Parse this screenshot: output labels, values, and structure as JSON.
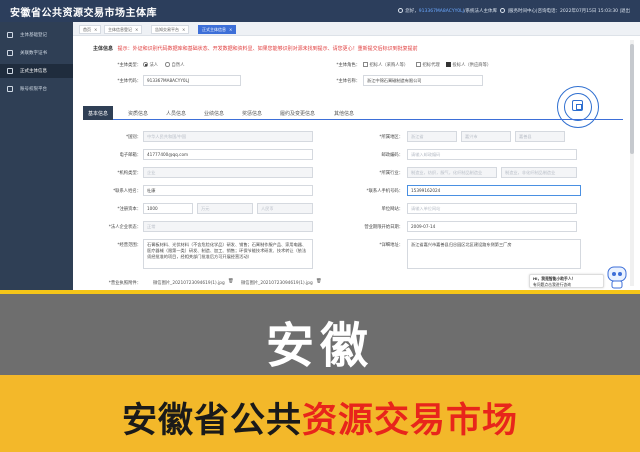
{
  "app": {
    "title": "安徽省公共资源交易市场主体库",
    "topbar": {
      "welcome_prefix": "您好，",
      "user": "913367MA8ACYY0LJ",
      "user_suffix": "/系统法人主体库",
      "help": "|服务时间中心|咨询电话：2022年07月15日 15:03:30 |退出"
    }
  },
  "sidebar": {
    "items": [
      {
        "label": "主体基础登记",
        "icon": "document-icon"
      },
      {
        "label": "关联数字证书",
        "icon": "certificate-icon"
      },
      {
        "label": "正式主体信息",
        "icon": "user-icon"
      },
      {
        "label": "账号权限平台",
        "icon": "settings-icon"
      }
    ],
    "active_index": 2
  },
  "page_tabs": [
    {
      "label": "首页",
      "close": "×"
    },
    {
      "label": "主体信息登记",
      "close": "×"
    },
    {
      "label": "告知交易平台",
      "close": "×"
    },
    {
      "label": "正式主体信息",
      "close": "×"
    }
  ],
  "hint": {
    "title": "主体信息",
    "text": "提示：外证和识别代码数据库和基础状态、开发数据和资料显、如果您能够识别对源未找到提示、请您更心！重新提交后标识到批复提前"
  },
  "subject": {
    "type_label": "*主体类型：",
    "type_options": [
      "法人",
      "自然人"
    ],
    "type_selected": 0,
    "roles_label": "*主体角色：",
    "role_options": [
      "招标人（采购人等）",
      "招标代理",
      "投标人（供应商等）"
    ],
    "role_selected": 2,
    "code_label": "*主体代码：",
    "code_value": "913367MA8ACYY0LJ",
    "name_label": "*主体名称：",
    "name_value": "浙江中锦石膏磁制造有限公司"
  },
  "form_tabs": [
    "基本信息",
    "资质信息",
    "人员信息",
    "业绩信息",
    "奖惩信息",
    "履约及变更信息",
    "其他信息"
  ],
  "form_tab_active": 0,
  "fields": {
    "country_label": "*国别：",
    "country_value": "中华人民共和国/中国",
    "region_label": "*所属地区：",
    "region_values": [
      "浙江省",
      "嘉兴市",
      "嘉善县"
    ],
    "email_label": "电子邮箱：",
    "email_value": "41777400@qq.com",
    "postcode_label": "邮政编码：",
    "postcode_value": "请输入邮政编码",
    "org_type_label": "*机构类型：",
    "org_type_value": "企业",
    "industry_label": "*所属行业：",
    "industry_values": [
      "制造业，纺织，服气，化纤制品制造业",
      "制造业，非化纤制品制造业"
    ],
    "legal_person_label": "*联系人姓名：",
    "legal_person_value": "杜康",
    "phone_label": "*联系人手机号码：",
    "phone_value": "15399162024",
    "capital_label": "*注册资本：",
    "capital_value": "1000",
    "capital_unit": "万元",
    "currency_value": "人民币",
    "website_label": "单位网站：",
    "website_value": "请输入单位网站",
    "ent_type_label": "*法人企业状态：",
    "ent_type_value": "正常",
    "found_label": "营业期限开始日期：",
    "found_value": "2009-07-14",
    "scope_label": "*经营范围：",
    "scope_value": "石膏板材料、光伏材料（不含危险化学品）研发、销售；石膏制作服产品、家用电器、医疗器械（限第一类）研发、制造、加工、销售；环保节能技术研发、技术转让（依法须经批准的项目，经相关部门批准后方可开展经营活动）",
    "address_label": "*详细地址：",
    "address_value": "浙江省嘉兴市嘉善县归谷园区北区建设路东侧第三厂房",
    "license_label": "*营业执照附件：",
    "license_files": [
      "微信图片_20210723094619(1).jpg",
      "微信图片_20210723094619(1).jpg"
    ]
  },
  "help_bubble": {
    "line1": "Hi，我是智能小助手人！",
    "line2": "有问题点击我进行咨询"
  },
  "banner": {
    "province": "安徽",
    "subtitle_a": "安徽省公共",
    "subtitle_b": "资源交易市场"
  }
}
